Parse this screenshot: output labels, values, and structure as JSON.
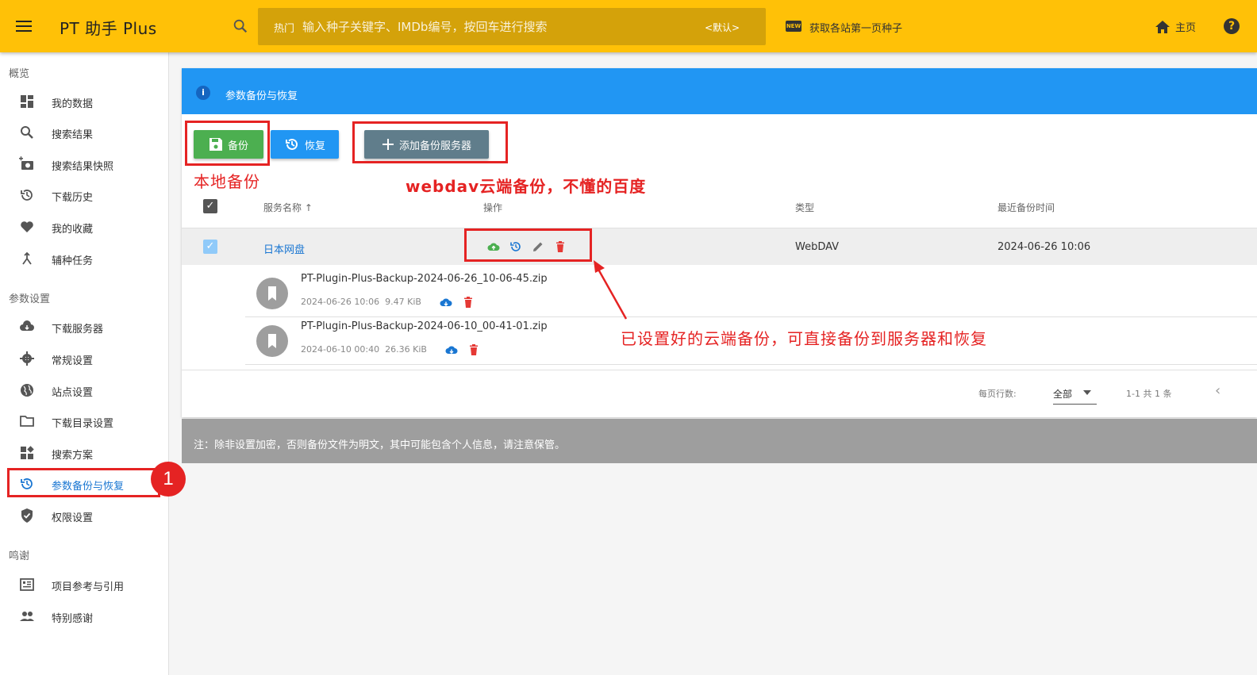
{
  "topbar": {
    "title": "PT 助手 Plus",
    "search_hot": "热门",
    "search_placeholder": "输入种子关键字、IMDb编号，按回车进行搜索",
    "search_default": "<默认>",
    "new_badge": "NEW",
    "fetch_link": "获取各站第一页种子",
    "home_link": "主页",
    "help": "?"
  },
  "sidebar": {
    "sections": [
      "概览",
      "参数设置",
      "鸣谢"
    ],
    "overview_items": [
      "我的数据",
      "搜索结果",
      "搜索结果快照",
      "下载历史",
      "我的收藏",
      "辅种任务"
    ],
    "settings_items": [
      "下载服务器",
      "常规设置",
      "站点设置",
      "下载目录设置",
      "搜索方案",
      "参数备份与恢复",
      "权限设置"
    ],
    "thanks_items": [
      "项目参考与引用",
      "特别感谢"
    ]
  },
  "panel": {
    "title": "参数备份与恢复",
    "buttons": {
      "backup": "备份",
      "restore": "恢复",
      "add_server": "添加备份服务器"
    },
    "table": {
      "headers": {
        "name": "服务名称 ↑",
        "actions": "操作",
        "type": "类型",
        "last": "最近备份时间"
      },
      "row": {
        "name": "日本网盘",
        "type": "WebDAV",
        "last": "2024-06-26 10:06"
      },
      "files": [
        {
          "name": "PT-Plugin-Plus-Backup-2024-06-26_10-06-45.zip",
          "time": "2024-06-26 10:06",
          "size": "9.47 KiB"
        },
        {
          "name": "PT-Plugin-Plus-Backup-2024-06-10_00-41-01.zip",
          "time": "2024-06-10 00:40",
          "size": "26.36 KiB"
        }
      ]
    },
    "footer": {
      "per_page_label": "每页行数:",
      "per_page_value": "全部",
      "range": "1-1 共 1 条",
      "prev": "‹"
    },
    "note": "注：除非设置加密，否则备份文件为明文，其中可能包含个人信息，请注意保管。"
  },
  "annotations": {
    "local": "本地备份",
    "webdav": "webdav云端备份，不懂的百度",
    "cloud": "已设置好的云端备份，可直接备份到服务器和恢复",
    "step": "1"
  },
  "colors": {
    "topbar": "#ffc107",
    "primary": "#2196f3",
    "success": "#4caf50",
    "danger": "#e53935",
    "annotation": "#e52323"
  }
}
